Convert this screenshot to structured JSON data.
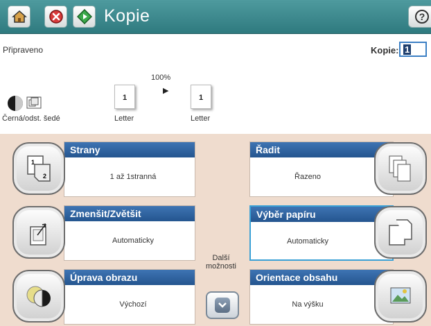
{
  "titlebar": {
    "title": "Kopie"
  },
  "status": {
    "text": "Připraveno",
    "copies_label": "Kopie:",
    "copies_value": "1"
  },
  "preview": {
    "color_mode": "Černá/odst. šedé",
    "zoom": "100%",
    "arrow": "▶",
    "input_pages": "1",
    "output_pages": "1",
    "input_paper": "Letter",
    "output_paper": "Letter"
  },
  "left_cards": [
    {
      "title": "Strany",
      "value": "1 až 1stranná",
      "icon": "duplex-icon"
    },
    {
      "title": "Zmenšit/Zvětšit",
      "value": "Automaticky",
      "icon": "resize-icon"
    },
    {
      "title": "Úprava obrazu",
      "value": "Výchozí",
      "icon": "image-adjust-icon"
    }
  ],
  "right_cards": [
    {
      "title": "Řadit",
      "value": "Řazeno",
      "icon": "collate-icon"
    },
    {
      "title": "Výběr papíru",
      "value": "Automaticky",
      "icon": "paper-select-icon",
      "selected": true
    },
    {
      "title": "Orientace obsahu",
      "value": "Na výšku",
      "icon": "orientation-icon"
    }
  ],
  "more": {
    "label_line1": "Další",
    "label_line2": "možnosti"
  },
  "colors": {
    "titlebar": "#2f7a7f",
    "panel": "#efdcce",
    "card_header": "#24558f",
    "selected_border": "#3aa1d6"
  }
}
